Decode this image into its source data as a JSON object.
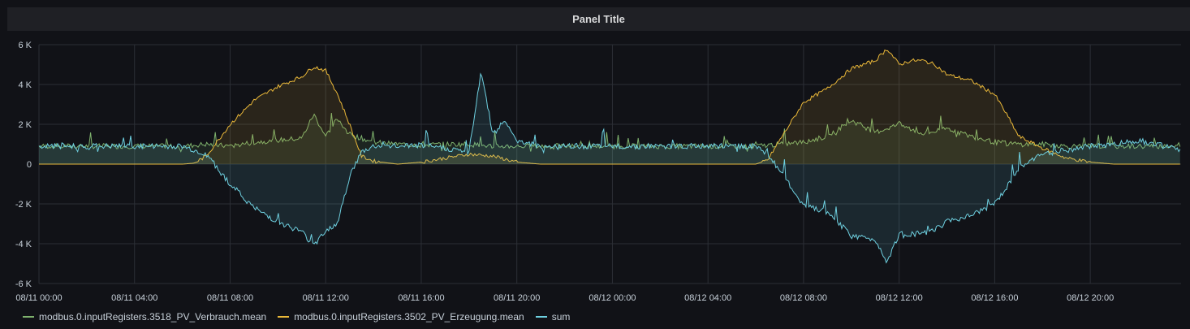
{
  "panel": {
    "title": "Panel Title"
  },
  "chart_data": {
    "type": "line",
    "title": "Panel Title",
    "y_ticks": [
      "6 K",
      "4 K",
      "2 K",
      "0",
      "-2 K",
      "-4 K",
      "-6 K"
    ],
    "y_tick_values": [
      6000,
      4000,
      2000,
      0,
      -2000,
      -4000,
      -6000
    ],
    "ylim": [
      -6000,
      6000
    ],
    "x_ticks": [
      "08/11 00:00",
      "08/11 04:00",
      "08/11 08:00",
      "08/11 12:00",
      "08/11 16:00",
      "08/11 20:00",
      "08/12 00:00",
      "08/12 04:00",
      "08/12 08:00",
      "08/12 12:00",
      "08/12 16:00",
      "08/12 20:00"
    ],
    "x_hours": [
      0,
      4,
      8,
      12,
      16,
      20,
      24,
      28,
      32,
      36,
      40,
      44
    ],
    "xlim_hours": [
      0,
      47.8
    ],
    "grid": true,
    "legend_position": "bottom-left",
    "series": [
      {
        "name": "modbus.0.inputRegisters.3518_PV_Verbrauch.mean",
        "color": "#7eb26d",
        "x_hours": [
          0,
          2,
          4,
          6,
          7,
          8,
          9,
          10,
          11,
          11.5,
          12,
          12.5,
          13,
          14,
          15,
          16,
          17,
          18,
          19,
          20,
          21,
          22,
          23,
          24,
          26,
          28,
          30,
          31,
          32,
          33,
          34,
          35,
          36,
          37,
          38,
          39,
          40,
          41,
          42,
          43,
          44,
          46,
          47.8
        ],
        "values": [
          900,
          900,
          900,
          900,
          1000,
          900,
          1100,
          1200,
          1300,
          2500,
          1400,
          2300,
          1500,
          1100,
          1000,
          950,
          1000,
          1000,
          900,
          900,
          900,
          900,
          900,
          900,
          900,
          900,
          900,
          1000,
          1100,
          1400,
          2200,
          1600,
          2000,
          1500,
          1800,
          1400,
          1100,
          1000,
          1000,
          900,
          900,
          900,
          900
        ]
      },
      {
        "name": "modbus.0.inputRegisters.3502_PV_Erzeugung.mean",
        "color": "#eab839",
        "x_hours": [
          0,
          5,
          6,
          6.5,
          7,
          8,
          9,
          10,
          11,
          11.5,
          12,
          12.5,
          13,
          13.5,
          14,
          15,
          16,
          17,
          18,
          19,
          20,
          21,
          24,
          29,
          30,
          30.5,
          31,
          32,
          33,
          34,
          35,
          35.5,
          36,
          36.5,
          37,
          37.5,
          38,
          39,
          40,
          40.5,
          41,
          42,
          43,
          44,
          45,
          47.8
        ],
        "values": [
          0,
          0,
          0,
          50,
          400,
          2000,
          3200,
          3900,
          4400,
          4900,
          4700,
          3500,
          2000,
          400,
          150,
          0,
          100,
          300,
          500,
          400,
          100,
          0,
          0,
          0,
          0,
          200,
          1200,
          3100,
          3800,
          4800,
          5200,
          5800,
          5000,
          5200,
          5200,
          5000,
          4500,
          4200,
          3500,
          2500,
          1400,
          800,
          300,
          100,
          0,
          0
        ]
      },
      {
        "name": "sum",
        "color": "#6ed0e0",
        "x_hours": [
          0,
          2,
          4,
          6,
          7,
          8,
          9,
          10,
          11,
          11.5,
          12,
          12.5,
          13,
          13.5,
          14,
          15,
          16,
          17,
          18,
          18.5,
          19,
          19.5,
          20,
          21,
          22,
          24,
          26,
          28,
          30,
          30.5,
          31,
          32,
          33,
          34,
          35,
          35.5,
          36,
          36.5,
          37,
          37.5,
          38,
          39,
          40,
          40.5,
          41,
          42,
          43,
          44,
          45,
          46,
          47.8
        ],
        "values": [
          900,
          900,
          900,
          900,
          500,
          -1000,
          -2200,
          -2900,
          -3400,
          -4100,
          -3300,
          -3000,
          -600,
          600,
          900,
          900,
          950,
          800,
          600,
          4700,
          1500,
          2200,
          1200,
          900,
          900,
          900,
          900,
          900,
          900,
          500,
          -300,
          -2100,
          -2400,
          -3600,
          -3800,
          -4900,
          -3500,
          -3500,
          -3500,
          -3300,
          -2900,
          -2600,
          -2000,
          -1200,
          -200,
          500,
          700,
          900,
          1000,
          1200,
          700
        ]
      }
    ]
  },
  "legend": {
    "items": [
      {
        "label": "modbus.0.inputRegisters.3518_PV_Verbrauch.mean",
        "color": "#7eb26d"
      },
      {
        "label": "modbus.0.inputRegisters.3502_PV_Erzeugung.mean",
        "color": "#eab839"
      },
      {
        "label": "sum",
        "color": "#6ed0e0"
      }
    ]
  }
}
